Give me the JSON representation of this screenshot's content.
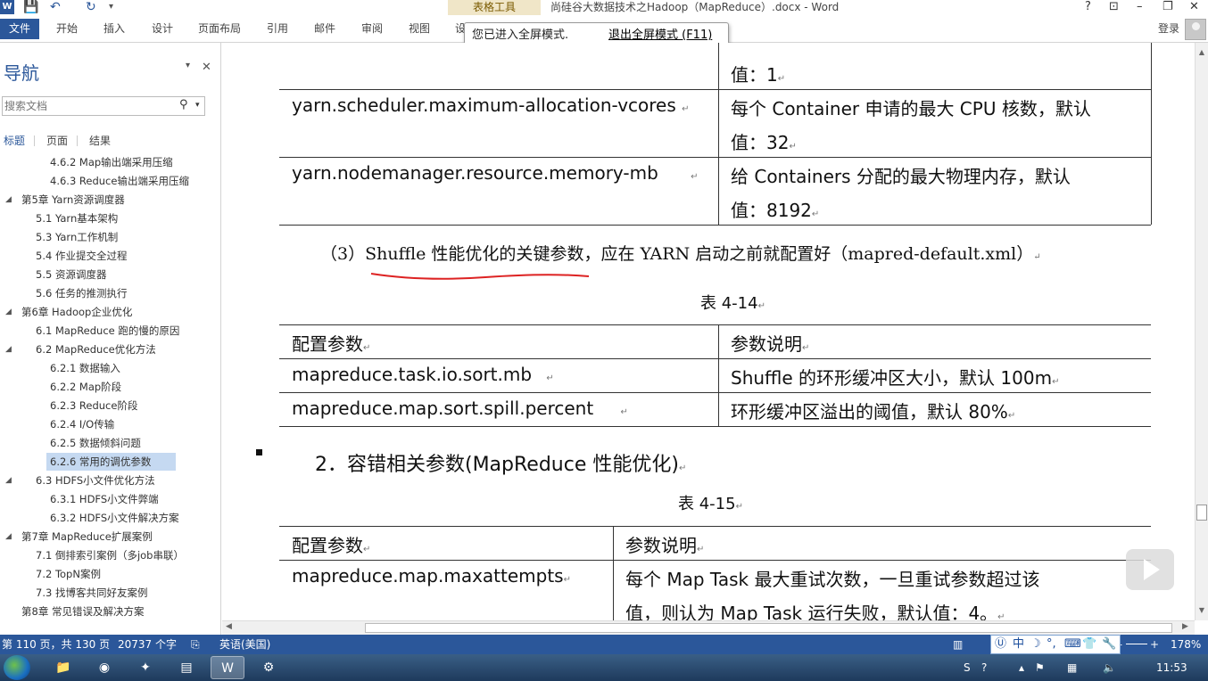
{
  "titlebar": {
    "word_logo": "W",
    "context_tab": "表格工具",
    "doc_title": "尚硅谷大数据技术之Hadoop（MapReduce）.docx - Word",
    "help": "?",
    "restore_ribbon": "⊡",
    "minimize": "–",
    "restore": "❐",
    "close": "✕"
  },
  "ribbon": {
    "file": "文件",
    "tabs": [
      "开始",
      "插入",
      "设计",
      "页面布局",
      "引用",
      "邮件",
      "审阅",
      "视图",
      "设"
    ],
    "login": "登录"
  },
  "tooltip": {
    "message": "您已进入全屏模式.",
    "exit_link": "退出全屏模式 (F11)"
  },
  "nav": {
    "title": "导航",
    "search_placeholder": "搜索文档",
    "tabs": [
      "标题",
      "页面",
      "结果"
    ],
    "items": [
      {
        "label": "4.6.2 Map输出端采用压缩",
        "level": 3,
        "expanded": null,
        "selected": false
      },
      {
        "label": "4.6.3 Reduce输出端采用压缩",
        "level": 3,
        "expanded": null,
        "selected": false
      },
      {
        "label": "第5章 Yarn资源调度器",
        "level": 1,
        "expanded": true,
        "selected": false
      },
      {
        "label": "5.1 Yarn基本架构",
        "level": 2,
        "expanded": null,
        "selected": false
      },
      {
        "label": "5.3 Yarn工作机制",
        "level": 2,
        "expanded": null,
        "selected": false
      },
      {
        "label": "5.4 作业提交全过程",
        "level": 2,
        "expanded": null,
        "selected": false
      },
      {
        "label": "5.5 资源调度器",
        "level": 2,
        "expanded": null,
        "selected": false
      },
      {
        "label": "5.6 任务的推测执行",
        "level": 2,
        "expanded": null,
        "selected": false
      },
      {
        "label": "第6章 Hadoop企业优化",
        "level": 1,
        "expanded": true,
        "selected": false
      },
      {
        "label": "6.1 MapReduce 跑的慢的原因",
        "level": 2,
        "expanded": null,
        "selected": false
      },
      {
        "label": "6.2 MapReduce优化方法",
        "level": 2,
        "expanded": true,
        "selected": false
      },
      {
        "label": "6.2.1 数据输入",
        "level": 3,
        "expanded": null,
        "selected": false
      },
      {
        "label": "6.2.2 Map阶段",
        "level": 3,
        "expanded": null,
        "selected": false
      },
      {
        "label": "6.2.3 Reduce阶段",
        "level": 3,
        "expanded": null,
        "selected": false
      },
      {
        "label": "6.2.4 I/O传输",
        "level": 3,
        "expanded": null,
        "selected": false
      },
      {
        "label": "6.2.5 数据倾斜问题",
        "level": 3,
        "expanded": null,
        "selected": false
      },
      {
        "label": "6.2.6 常用的调优参数",
        "level": 3,
        "expanded": null,
        "selected": true
      },
      {
        "label": "6.3 HDFS小文件优化方法",
        "level": 2,
        "expanded": true,
        "selected": false
      },
      {
        "label": "6.3.1 HDFS小文件弊端",
        "level": 3,
        "expanded": null,
        "selected": false
      },
      {
        "label": "6.3.2 HDFS小文件解决方案",
        "level": 3,
        "expanded": null,
        "selected": false
      },
      {
        "label": "第7章 MapReduce扩展案例",
        "level": 1,
        "expanded": true,
        "selected": false
      },
      {
        "label": "7.1 倒排索引案例（多job串联）",
        "level": 2,
        "expanded": null,
        "selected": false
      },
      {
        "label": "7.2 TopN案例",
        "level": 2,
        "expanded": null,
        "selected": false
      },
      {
        "label": "7.3 找博客共同好友案例",
        "level": 2,
        "expanded": null,
        "selected": false
      },
      {
        "label": "第8章 常见错误及解决方案",
        "level": 1,
        "expanded": null,
        "selected": false
      }
    ]
  },
  "document": {
    "table1": {
      "row0_desc_tail": "值：1",
      "rows": [
        {
          "param": "yarn.scheduler.maximum-allocation-vcores",
          "desc1": "每个 Container 申请的最大 CPU 核数，默认",
          "desc2": "值：32"
        },
        {
          "param": "yarn.nodemanager.resource.memory-mb",
          "desc1": "给 Containers 分配的最大物理内存，默认",
          "desc2": "值：8192"
        }
      ]
    },
    "para3": "（3）Shuffle 性能优化的关键参数，应在 YARN 启动之前就配置好（mapred-default.xml）",
    "caption14": "表 4-14",
    "table14": {
      "headers": [
        "配置参数",
        "参数说明"
      ],
      "rows": [
        {
          "param": "mapreduce.task.io.sort.mb",
          "desc": "Shuffle 的环形缓冲区大小，默认 100m"
        },
        {
          "param": "mapreduce.map.sort.spill.percent",
          "desc": "环形缓冲区溢出的阈值，默认 80%"
        }
      ]
    },
    "heading2": "2．容错相关参数(MapReduce 性能优化)",
    "caption15": "表 4-15",
    "table15": {
      "headers": [
        "配置参数",
        "参数说明"
      ],
      "rows": [
        {
          "param": "mapreduce.map.maxattempts",
          "desc1": "每个 Map Task 最大重试次数，一旦重试参数超过该",
          "desc2": "值，则认为 Map Task 运行失败，默认值：4。"
        }
      ]
    },
    "para_mark": "↵"
  },
  "statusbar": {
    "page": "第 110 页，共 130 页",
    "words": "20737 个字",
    "language": "英语(美国)",
    "zoom": "178%",
    "zoom_minus": "–",
    "zoom_plus": "+"
  },
  "ime": {
    "label": "中"
  },
  "taskbar": {
    "clock": "11:53"
  },
  "colors": {
    "accent": "#2b579a",
    "underline_red": "#d22"
  }
}
